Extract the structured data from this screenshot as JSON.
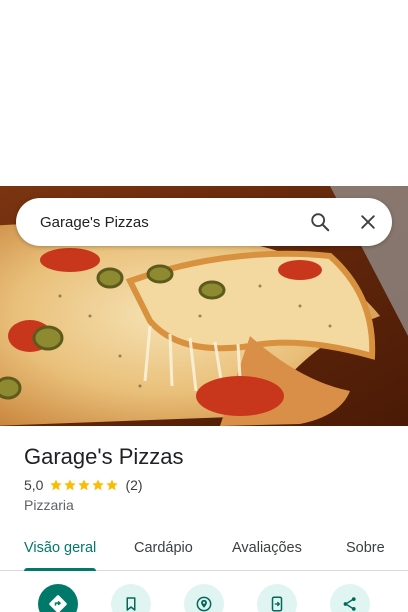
{
  "search": {
    "query": "Garage's Pizzas"
  },
  "icons": {
    "search": "search-icon",
    "close": "close-icon"
  },
  "place": {
    "name": "Garage's Pizzas",
    "rating": "5,0",
    "rating_value": 5.0,
    "stars_max": 5,
    "review_count": "(2)",
    "category": "Pizzaria"
  },
  "tabs": [
    {
      "label": "Visão geral",
      "active": true
    },
    {
      "label": "Cardápio",
      "active": false
    },
    {
      "label": "Avaliações",
      "active": false
    },
    {
      "label": "Sobre",
      "active": false
    }
  ],
  "actions": [
    {
      "icon": "directions-icon",
      "primary": true
    },
    {
      "icon": "bookmark-icon",
      "primary": false
    },
    {
      "icon": "nearby-icon",
      "primary": false
    },
    {
      "icon": "send-to-phone-icon",
      "primary": false
    },
    {
      "icon": "share-icon",
      "primary": false
    }
  ],
  "colors": {
    "accent": "#00796b",
    "star": "#fbbc04",
    "action_bg": "#e0f5f2"
  }
}
